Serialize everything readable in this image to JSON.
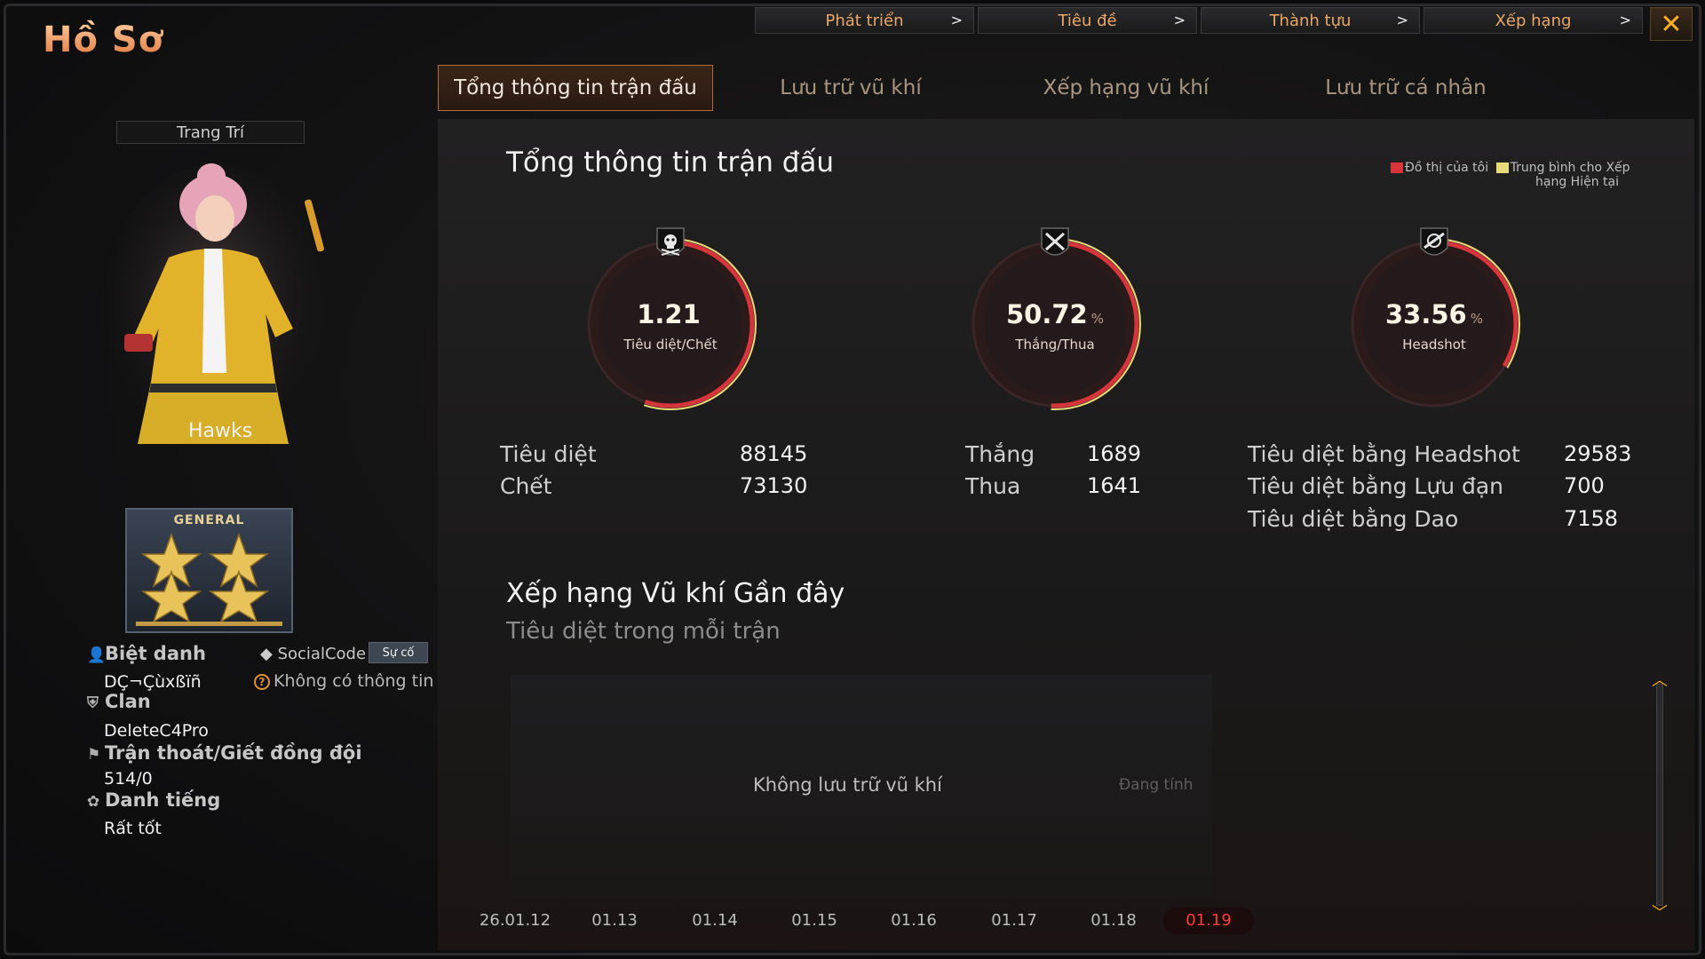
{
  "header": {
    "title": "Hồ Sơ",
    "close_label": "✕"
  },
  "top_buttons": [
    {
      "label": "Phát triển"
    },
    {
      "label": "Tiêu đề"
    },
    {
      "label": "Thành tựu"
    },
    {
      "label": "Xếp hạng"
    }
  ],
  "tabs": [
    {
      "label": "Tổng thông tin trận đấu",
      "active": true
    },
    {
      "label": "Lưu trữ vũ khí",
      "active": false
    },
    {
      "label": "Xếp hạng vũ khí",
      "active": false
    },
    {
      "label": "Lưu trữ cá nhân",
      "active": false
    }
  ],
  "profile": {
    "decoration_label": "Trang Trí",
    "character_name": "Hawks",
    "rank_label": "GENERAL",
    "nickname_label": "Biệt danh",
    "nickname": "DÇ¬Çùxßïñ",
    "social_code_label": "SocialCode",
    "social_code_button": "Sự cố",
    "social_code_value": "Không có thông tin",
    "clan_label": "Clan",
    "clan": "DeleteC4Pro",
    "desert_label": "Trận thoát/Giết đồng đội",
    "desert_value": "514/0",
    "reputation_label": "Danh tiếng",
    "reputation": "Rất tốt"
  },
  "overview": {
    "title": "Tổng thông tin trận đấu",
    "legend": {
      "mine": "Đồ thị của tôi",
      "avg_line1": "Trung bình cho Xếp",
      "avg_line2": "hạng Hiện tại",
      "mine_color": "#d8343c",
      "avg_color": "#e8dc7a"
    },
    "gauges": [
      {
        "value": "1.21",
        "unit": "",
        "label": "Tiêu diệt/Chết",
        "fill": 0.55,
        "icon": "skull-icon"
      },
      {
        "value": "50.72",
        "unit": "%",
        "label": "Thắng/Thua",
        "fill": 0.5072,
        "icon": "crossed-swords-icon"
      },
      {
        "value": "33.56",
        "unit": "%",
        "label": "Headshot",
        "fill": 0.3356,
        "icon": "headshot-rifle-icon"
      }
    ],
    "kills_label": "Tiêu diệt",
    "kills": "88145",
    "deaths_label": "Chết",
    "deaths": "73130",
    "wins_label": "Thắng",
    "wins": "1689",
    "losses_label": "Thua",
    "losses": "1641",
    "hs_kills_label": "Tiêu diệt bằng Headshot",
    "hs_kills": "29583",
    "grenade_kills_label": "Tiêu diệt bằng Lựu đạn",
    "grenade_kills": "700",
    "knife_kills_label": "Tiêu diệt bằng Dao",
    "knife_kills": "7158"
  },
  "recent_weapons": {
    "title": "Xếp hạng Vũ khí Gần đây",
    "subtitle": "Tiêu diệt trong mỗi trận",
    "empty_text": "Không lưu trữ vũ khí",
    "computing_text": "Đang tính",
    "dates": [
      "26.01.12",
      "01.13",
      "01.14",
      "01.15",
      "01.16",
      "01.17",
      "01.18",
      "01.19"
    ],
    "active_date": "01.19"
  }
}
